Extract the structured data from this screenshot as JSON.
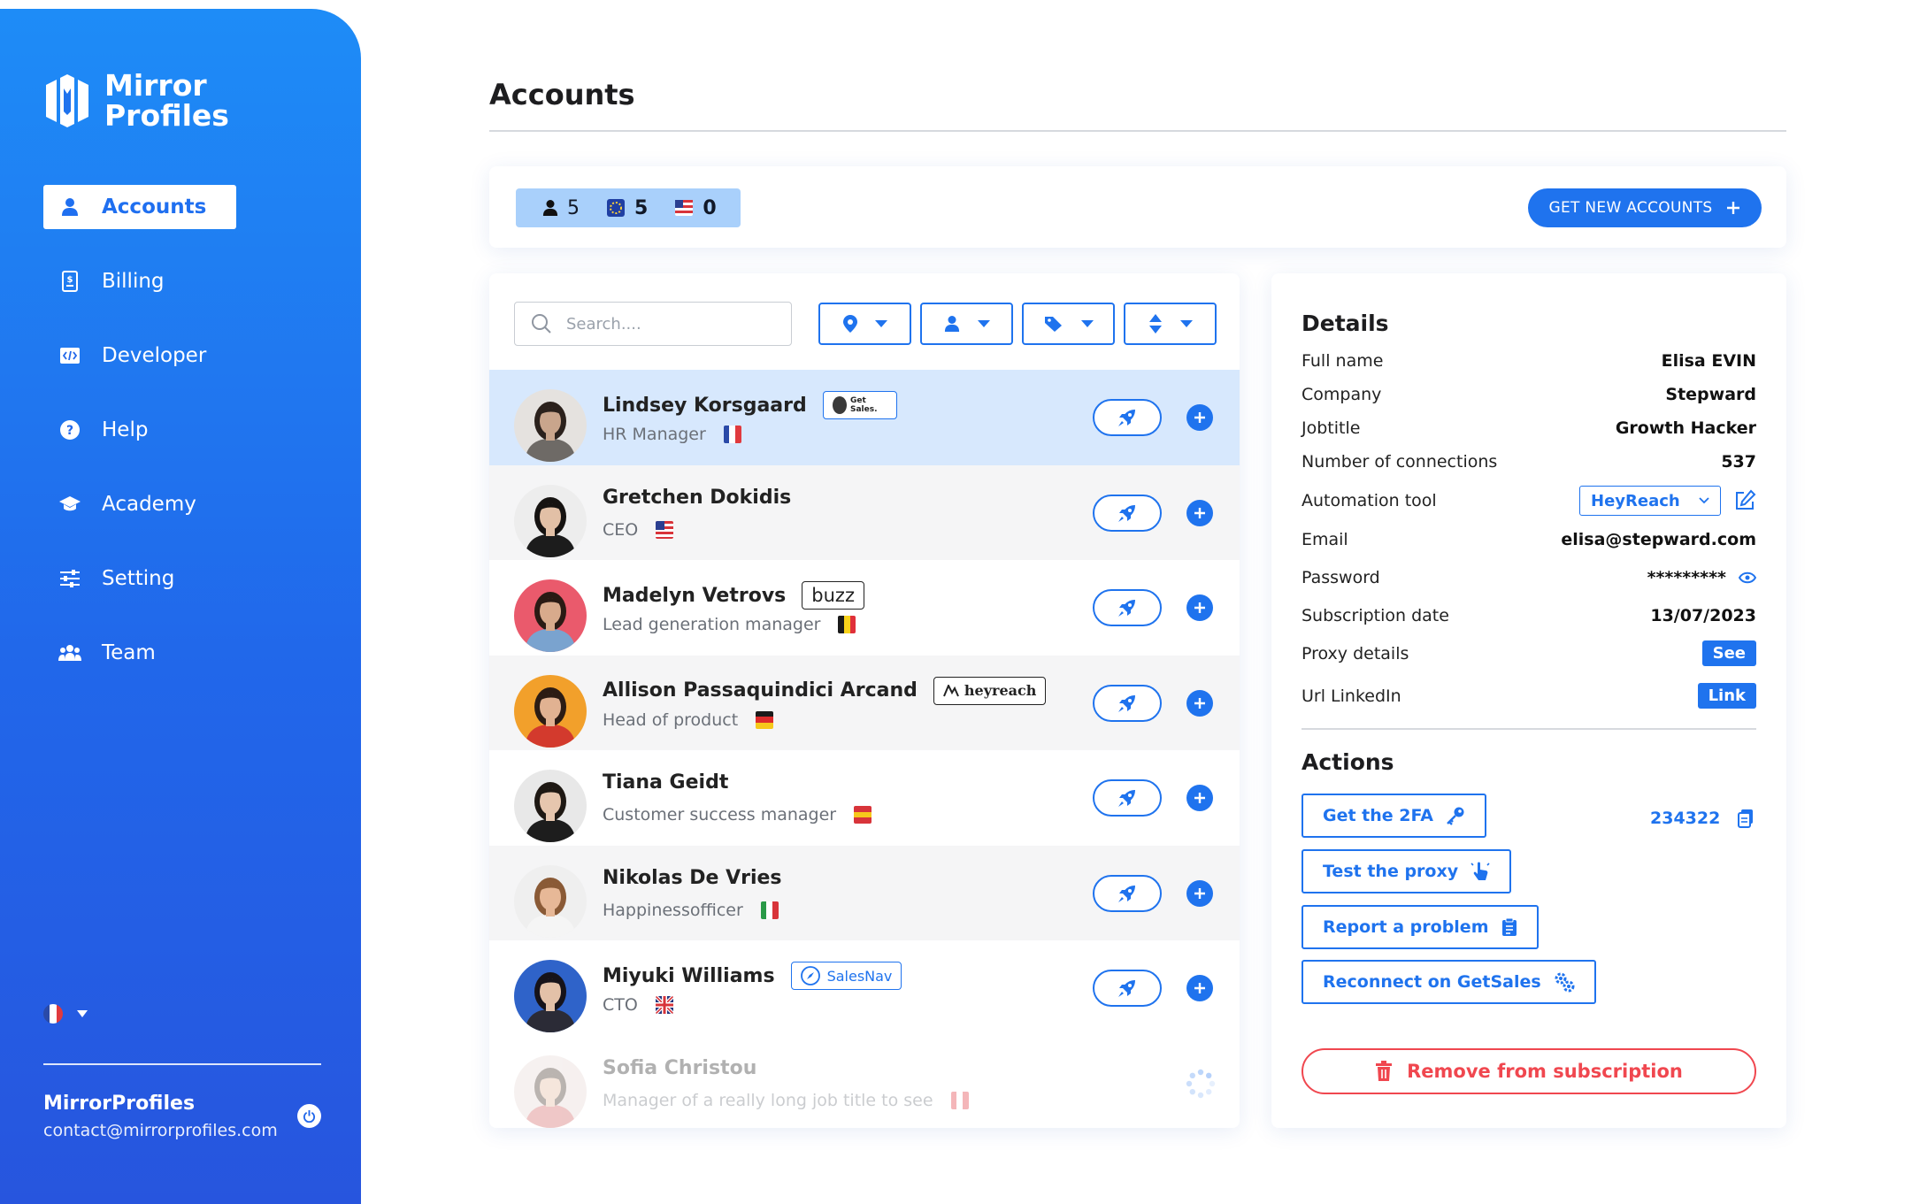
{
  "brand": {
    "line1": "Mirror",
    "line2": "Profiles"
  },
  "nav": [
    {
      "label": "Accounts",
      "icon": "user-icon",
      "active": true
    },
    {
      "label": "Billing",
      "icon": "billing-icon",
      "active": false
    },
    {
      "label": "Developer",
      "icon": "code-icon",
      "active": false
    },
    {
      "label": "Help",
      "icon": "help-icon",
      "active": false
    },
    {
      "label": "Academy",
      "icon": "graduation-cap-icon",
      "active": false
    },
    {
      "label": "Setting",
      "icon": "sliders-icon",
      "active": false
    },
    {
      "label": "Team",
      "icon": "team-icon",
      "active": false
    }
  ],
  "sidebar_user": {
    "name": "MirrorProfiles",
    "email": "contact@mirrorprofiles.com"
  },
  "header": {
    "title": "Accounts"
  },
  "counts": {
    "total": "5",
    "eu": "5",
    "us": "0"
  },
  "get_new_label": "GET NEW ACCOUNTS",
  "search": {
    "placeholder": "Search...."
  },
  "accounts": [
    {
      "name": "Lindsey Korsgaard",
      "job": "HR Manager",
      "flag": "fr",
      "badge": "getsales",
      "badge_text": "Get Sales.",
      "state": "selected",
      "skin": "#c9a58c",
      "hair": "#2b211c",
      "bg": "#e5e2df",
      "shirt": "#6e6a66"
    },
    {
      "name": "Gretchen Dokidis",
      "job": "CEO",
      "flag": "us",
      "badge": "",
      "badge_text": "",
      "state": "alt",
      "skin": "#e2c0a6",
      "hair": "#161311",
      "bg": "#ededed",
      "shirt": "#1c1c1c"
    },
    {
      "name": "Madelyn Vetrovs",
      "job": "Lead generation manager",
      "flag": "be",
      "badge": "buzz",
      "badge_text": "buzz",
      "state": "normal",
      "skin": "#d8aa8c",
      "hair": "#2a1a14",
      "bg": "#ea5a6c",
      "shirt": "#7aa3cf"
    },
    {
      "name": "Allison Passaquindici Arcand",
      "job": "Head of product",
      "flag": "de",
      "badge": "heyreach",
      "badge_text": "heyreach",
      "state": "alt",
      "skin": "#e1b292",
      "hair": "#2c1c14",
      "bg": "#f2a02b",
      "shirt": "#d33a2d"
    },
    {
      "name": "Tiana Geidt",
      "job": "Customer success manager",
      "flag": "es",
      "badge": "",
      "badge_text": "",
      "state": "normal",
      "skin": "#e6c6ae",
      "hair": "#1e1813",
      "bg": "#e8e8e8",
      "shirt": "#1d1d1d"
    },
    {
      "name": "Nikolas De Vries",
      "job": "Happinessofficer",
      "flag": "it",
      "badge": "",
      "badge_text": "",
      "state": "alt",
      "skin": "#e7b897",
      "hair": "#8a5a36",
      "bg": "#efefef",
      "shirt": "#f5f5f5"
    },
    {
      "name": "Miyuki Williams",
      "job": "CTO",
      "flag": "gb",
      "badge": "salesnav",
      "badge_text": "SalesNav",
      "state": "normal",
      "skin": "#e3c1a8",
      "hair": "#16131a",
      "bg": "#2f63c9",
      "shirt": "#2b2b36"
    },
    {
      "name": "Sofia Christou",
      "job": "Manager of a really long job title to see",
      "flag": "ca",
      "badge": "",
      "badge_text": "",
      "state": "faded",
      "skin": "#e2b89a",
      "hair": "#3a281e",
      "bg": "#e6d6d3",
      "shirt": "#d06060"
    }
  ],
  "details": {
    "title": "Details",
    "rows": [
      {
        "label": "Full name",
        "value": "Elisa EVIN"
      },
      {
        "label": "Company",
        "value": "Stepward"
      },
      {
        "label": "Jobtitle",
        "value": "Growth Hacker"
      },
      {
        "label": "Number of connections",
        "value": "537"
      },
      {
        "label": "Automation tool",
        "value": "HeyReach"
      },
      {
        "label": "Email",
        "value": "elisa@stepward.com"
      },
      {
        "label": "Password",
        "value": "*********"
      },
      {
        "label": "Subscription date",
        "value": "13/07/2023"
      },
      {
        "label": "Proxy details",
        "value": "See"
      },
      {
        "label": "Url LinkedIn",
        "value": "Link"
      }
    ]
  },
  "actions": {
    "title": "Actions",
    "get_2fa": "Get the 2FA",
    "code": "234322",
    "test_proxy": "Test the proxy",
    "report": "Report a problem",
    "reconnect": "Reconnect on GetSales",
    "remove": "Remove from subscription"
  },
  "colors": {
    "primary": "#1f73ee",
    "danger": "#f0474f",
    "selected_row": "#d7e8fd",
    "counts_bg": "#a9d0fb"
  }
}
